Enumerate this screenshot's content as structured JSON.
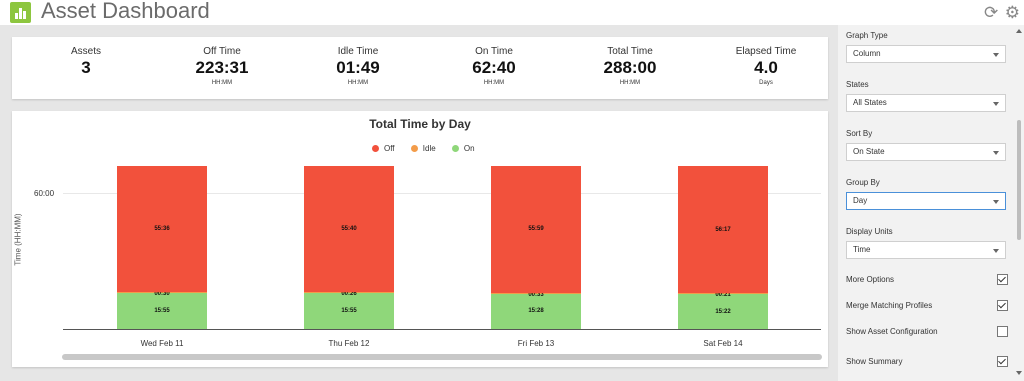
{
  "header": {
    "title": "Asset Dashboard",
    "icons": [
      "bar-chart-logo-icon",
      "refresh-icon",
      "gear-icon"
    ],
    "refresh_glyph": "⟳",
    "settings_glyph": "⚙"
  },
  "summary": [
    {
      "label": "Assets",
      "value": "3",
      "unit": ""
    },
    {
      "label": "Off Time",
      "value": "223:31",
      "unit": "HH:MM"
    },
    {
      "label": "Idle Time",
      "value": "01:49",
      "unit": "HH:MM"
    },
    {
      "label": "On Time",
      "value": "62:40",
      "unit": "HH:MM"
    },
    {
      "label": "Total Time",
      "value": "288:00",
      "unit": "HH:MM"
    },
    {
      "label": "Elapsed Time",
      "value": "4.0",
      "unit": "Days"
    }
  ],
  "chart_data": {
    "type": "bar",
    "stacked": true,
    "title": "Total Time by Day",
    "xlabel": "",
    "ylabel": "Time (HH:MM)",
    "categories": [
      "Wed Feb 11",
      "Thu Feb 12",
      "Fri Feb 13",
      "Sat Feb 14"
    ],
    "series": [
      {
        "name": "On",
        "color": "#8fd77a",
        "values": [
          15.92,
          15.92,
          15.47,
          15.37
        ],
        "labels": [
          "15:55",
          "15:55",
          "15:28",
          "15:22"
        ]
      },
      {
        "name": "Idle",
        "color": "#f39c4a",
        "values": [
          0.5,
          0.42,
          0.55,
          0.35
        ],
        "labels": [
          "00:30",
          "00:26",
          "00:33",
          "00:21"
        ]
      },
      {
        "name": "Off",
        "color": "#f2513c",
        "values": [
          55.6,
          55.67,
          55.98,
          56.28
        ],
        "labels": [
          "55:36",
          "55:40",
          "55:59",
          "56:17"
        ]
      }
    ],
    "legend_order": [
      "Off",
      "Idle",
      "On"
    ],
    "y_tick_labels": [
      "60:00"
    ],
    "y_tick_values": [
      60
    ],
    "ylim": [
      0,
      72
    ],
    "legend_position": "top-center",
    "grid": true
  },
  "sidebar": {
    "fields": [
      {
        "label": "Graph Type",
        "value": "Column"
      },
      {
        "label": "States",
        "value": "All States"
      },
      {
        "label": "Sort By",
        "value": "On State"
      },
      {
        "label": "Group By",
        "value": "Day"
      },
      {
        "label": "Display Units",
        "value": "Time"
      }
    ],
    "options": [
      {
        "label": "More Options",
        "checked": true
      },
      {
        "label": "Merge Matching Profiles",
        "checked": true
      },
      {
        "label": "Show Asset Configuration",
        "checked": false
      },
      {
        "label": "Show Summary",
        "checked": true
      }
    ]
  }
}
